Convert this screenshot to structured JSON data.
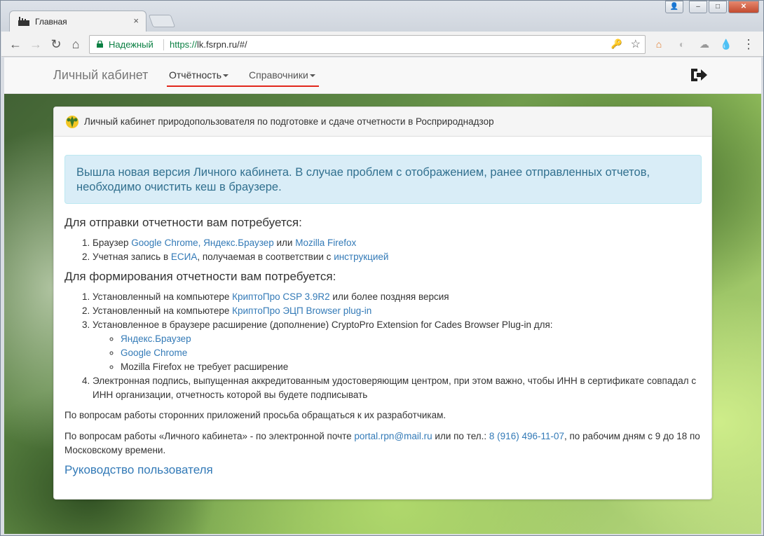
{
  "browser": {
    "tab_title": "Главная",
    "tab_close": "×",
    "secure_label": "Надежный",
    "url_scheme": "https://",
    "url_rest": "lk.fsrpn.ru/#/",
    "window_controls": {
      "user": "👤",
      "minimize": "–",
      "maximize": "□",
      "close": "✕"
    },
    "nav_icons": {
      "back": "←",
      "forward": "→",
      "reload": "↻",
      "home": "⌂"
    },
    "toolbar_icons": {
      "key": "🔑",
      "star": "☆",
      "home_ext": "⌂",
      "ext2": "◐",
      "cloud": "☁",
      "drop": "💧",
      "menu": "⋮"
    }
  },
  "navbar": {
    "brand": "Личный кабинет",
    "items": [
      {
        "label": "Отчётность"
      },
      {
        "label": "Справочники"
      }
    ]
  },
  "panel": {
    "heading": "Личный кабинет природопользователя по подготовке и сдаче отчетности в Росприроднадзор",
    "alert": "Вышла новая версия Личного кабинета. В случае проблем с отображением, ранее отправленных отчетов, необходимо очистить кеш в браузере.",
    "section1": {
      "title": "Для отправки отчетности вам потребуется:",
      "item1": {
        "prefix": "Браузер ",
        "link1": "Google Chrome, Яндекс.Браузер",
        "mid": " или ",
        "link2": "Mozilla Firefox"
      },
      "item2": {
        "prefix": "Учетная запись в ",
        "link1": "ЕСИА",
        "mid": ", получаемая в соответствии с ",
        "link2": "инструкцией"
      }
    },
    "section2": {
      "title": "Для формирования отчетности вам потребуется:",
      "item1": {
        "prefix": "Установленный на компьютере ",
        "link": "КриптоПро CSP 3.9R2",
        "suffix": " или более поздняя версия"
      },
      "item2": {
        "prefix": "Установленный на компьютере ",
        "link": "КриптоПро ЭЦП Browser plug-in"
      },
      "item3": {
        "text": "Установленное в браузере расширение (дополнение) CryptoPro Extension for Cades Browser Plug-in для:",
        "sub1": "Яндекс.Браузер",
        "sub2": "Google Chrome",
        "sub3": "Mozilla Firefox не требует расширение"
      },
      "item4": "Электронная подпись, выпущенная аккредитованным удостоверяющим центром, при этом важно, чтобы ИНН в сертификате совпадал с ИНН организации, отчетность которой вы будете подписывать"
    },
    "note1": "По вопросам работы сторонних приложений просьба обращаться к их разработчикам.",
    "note2": {
      "prefix": "По вопросам работы «Личного кабинета» - по электронной почте ",
      "email": "portal.rpn@mail.ru",
      "mid": " или по тел.: ",
      "phone": "8 (916) 496-11-07",
      "suffix": ", по рабочим дням с 9 до 18 по Московскому времени."
    },
    "guide_link": "Руководство пользователя"
  },
  "colors": {
    "accent_red": "#e1261c",
    "link": "#337ab7",
    "alert_text": "#31708f",
    "secure_green": "#0b8043"
  }
}
